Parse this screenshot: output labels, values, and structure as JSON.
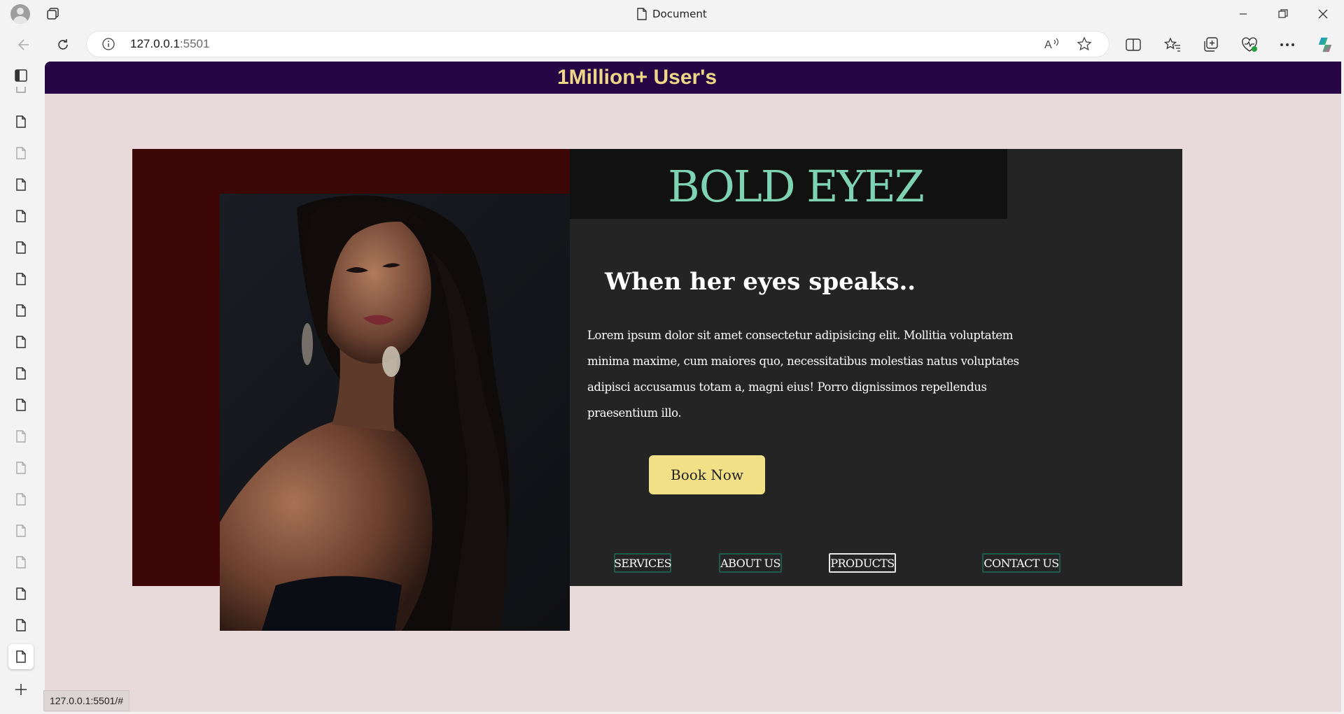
{
  "browser": {
    "window_title": "Document",
    "url_host": "127.0.0.1",
    "url_port": ":5501",
    "status_url": "127.0.0.1:5501/#"
  },
  "page": {
    "promo_banner": "1Million+ User's",
    "brand": "BOLD EYEZ",
    "tagline": "When her eyes speaks..",
    "description": "Lorem ipsum dolor sit amet consectetur adipisicing elit. Mollitia voluptatem minima maxime, cum maiores quo, necessitatibus molestias natus voluptates adipisci accusamus totam a, magni eius! Porro dignissimos repellendus praesentium illo.",
    "cta_label": "Book Now",
    "nav": [
      {
        "label": "SERVICES"
      },
      {
        "label": "ABOUT US"
      },
      {
        "label": "PRODUCTS"
      },
      {
        "label": "CONTACT US"
      }
    ]
  },
  "colors": {
    "banner_bg": "#260645",
    "banner_text": "#eed888",
    "page_bg": "#e8dadb",
    "maroon_panel": "#3e0707",
    "dark_panel": "#242424",
    "brand_text": "#7ed3b4",
    "cta_bg": "#f2e086"
  },
  "icons": {
    "photo": "portrait-photo",
    "tabs": "document-icon"
  }
}
